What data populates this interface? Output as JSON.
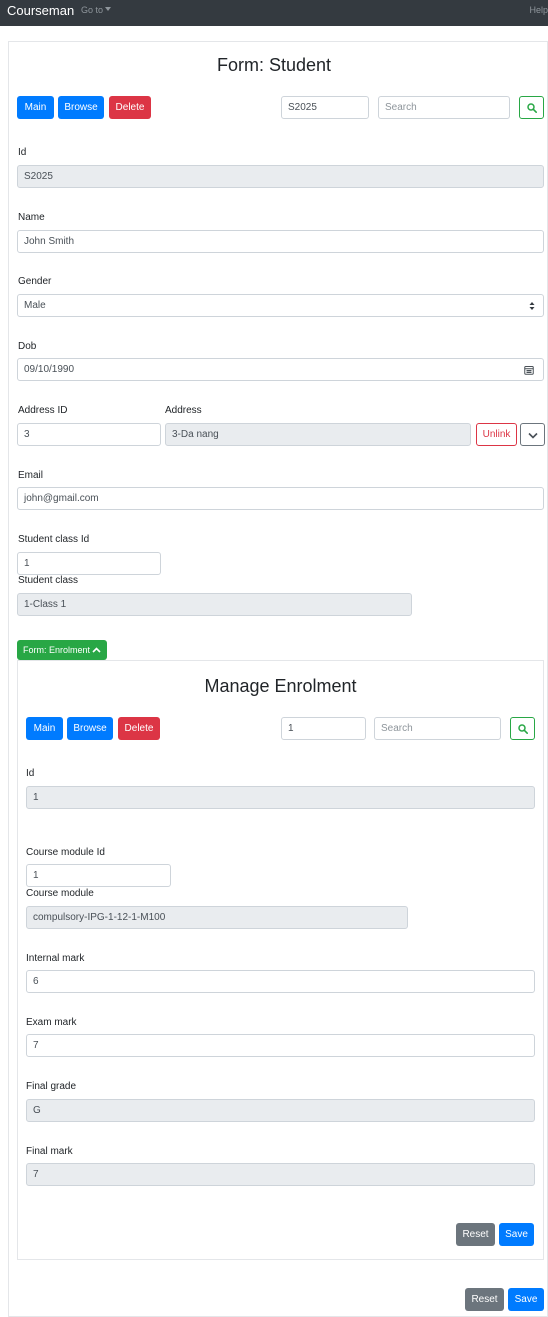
{
  "navbar": {
    "brand": "Courseman",
    "goto": "Go to",
    "help": "Help"
  },
  "student_form": {
    "title": "Form: Student",
    "buttons": {
      "main": "Main",
      "browse": "Browse",
      "delete": "Delete"
    },
    "id_lookup_value": "S2025",
    "search_placeholder": "Search",
    "fields": {
      "id": {
        "label": "Id",
        "value": "S2025"
      },
      "name": {
        "label": "Name",
        "value": "John Smith"
      },
      "gender": {
        "label": "Gender",
        "value": "Male"
      },
      "dob": {
        "label": "Dob",
        "value": "09/10/1990"
      },
      "address_id": {
        "label": "Address ID",
        "value": "3"
      },
      "address": {
        "label": "Address",
        "value": "3-Da nang"
      },
      "email": {
        "label": "Email",
        "value": "john@gmail.com"
      },
      "student_class_id": {
        "label": "Student class Id",
        "value": "1"
      },
      "student_class": {
        "label": "Student class",
        "value": "1-Class 1"
      }
    },
    "unlink_label": "Unlink",
    "reset_label": "Reset",
    "save_label": "Save"
  },
  "enrolment_toggle": "Form: Enrolment",
  "enrolment_form": {
    "title": "Manage Enrolment",
    "buttons": {
      "main": "Main",
      "browse": "Browse",
      "delete": "Delete"
    },
    "id_lookup_value": "1",
    "search_placeholder": "Search",
    "fields": {
      "id": {
        "label": "Id",
        "value": "1"
      },
      "course_module_id": {
        "label": "Course module Id",
        "value": "1"
      },
      "course_module": {
        "label": "Course module",
        "value": "compulsory-IPG-1-12-1-M100"
      },
      "internal_mark": {
        "label": "Internal mark",
        "value": "6"
      },
      "exam_mark": {
        "label": "Exam mark",
        "value": "7"
      },
      "final_grade": {
        "label": "Final grade",
        "value": "G"
      },
      "final_mark": {
        "label": "Final mark",
        "value": "7"
      }
    },
    "reset_label": "Reset",
    "save_label": "Save"
  },
  "colors": {
    "primary": "#007bff",
    "danger": "#dc3545",
    "success": "#28a745",
    "secondary": "#6c757d",
    "navbar": "#343a40"
  },
  "icons": {
    "search": "search-icon",
    "select": "select-arrows-icon",
    "calendar": "calendar-icon",
    "dropdown": "chevron-down-icon",
    "toggle": "chevron-up-icon"
  }
}
